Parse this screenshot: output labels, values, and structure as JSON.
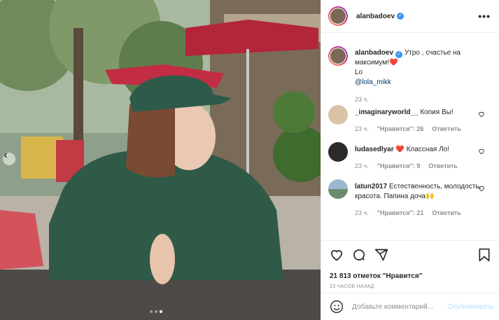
{
  "post": {
    "carousel": {
      "slide_count": 3,
      "active_index": 2
    }
  },
  "header": {
    "username": "alanbadoev",
    "more_glyph": "•••"
  },
  "caption": {
    "username": "alanbadoev",
    "text": "Утро , счастье на максимум!",
    "emoji": "❤️",
    "line2": "Lo",
    "mention": "@lola_mikk",
    "time": "23 ч."
  },
  "comments": [
    {
      "username": "_imaginaryworld__",
      "text": "Копия Вы!",
      "time": "23 ч.",
      "likes": "\"Нравится\": 26",
      "reply": "Ответить"
    },
    {
      "username": "ludasedlyar",
      "text": "Классная Ло!",
      "emoji": "❤️",
      "time": "23 ч.",
      "likes": "\"Нравится\": 9",
      "reply": "Ответить"
    },
    {
      "username": "latun2017",
      "text": "Естественность, молодость, красота. Папина доча",
      "emoji": "🙌",
      "time": "23 ч.",
      "likes": "\"Нравится\": 21",
      "reply": "Ответить"
    }
  ],
  "actions": {
    "icons": [
      "heart-icon",
      "comment-icon",
      "share-icon",
      "save-icon"
    ],
    "likes": "21 813 отметок \"Нравится\"",
    "timestamp": "23 ЧАСОВ НАЗАД"
  },
  "composer": {
    "placeholder": "Добавьте комментарий...",
    "publish": "Опубликовать"
  },
  "colors": {
    "accent": "#3897f0",
    "link": "#00376b",
    "publish_disabled": "#b2dffc",
    "heart": "#ed4956"
  }
}
